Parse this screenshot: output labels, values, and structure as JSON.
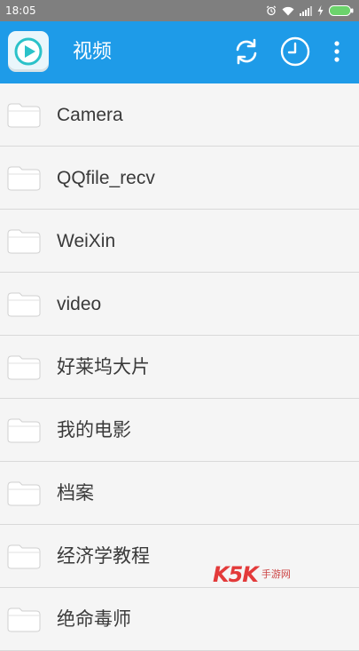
{
  "status_bar": {
    "time": "18:05",
    "icons": [
      "alarm-icon",
      "wifi-icon",
      "signal-icon",
      "charging-icon",
      "battery-icon"
    ]
  },
  "app_bar": {
    "title": "视频",
    "color": "#1e9be8",
    "actions": [
      "refresh-icon",
      "history-clock-icon",
      "more-vert-icon"
    ]
  },
  "folders": [
    {
      "label": "Camera"
    },
    {
      "label": "QQfile_recv"
    },
    {
      "label": "WeiXin"
    },
    {
      "label": "video"
    },
    {
      "label": "好莱坞大片"
    },
    {
      "label": "我的电影"
    },
    {
      "label": "档案"
    },
    {
      "label": "经济学教程"
    },
    {
      "label": "绝命毒师"
    }
  ],
  "watermark": {
    "brand": "K5K",
    "text": "手游网"
  }
}
